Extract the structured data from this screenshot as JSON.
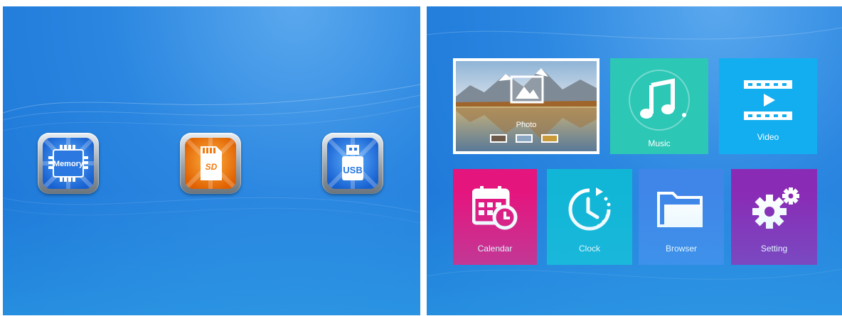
{
  "left_screen": {
    "sources": [
      {
        "name": "Memory",
        "icon": "memory-chip-icon",
        "color": "#2f7de6"
      },
      {
        "name": "SD",
        "icon": "sd-card-icon",
        "color": "#f07a10"
      },
      {
        "name": "USB",
        "icon": "usb-drive-icon",
        "color": "#2f7de6"
      }
    ]
  },
  "right_screen": {
    "tiles": {
      "photo": {
        "label": "Photo",
        "icon": "image-icon",
        "selected": true
      },
      "music": {
        "label": "Music",
        "icon": "music-note-icon",
        "color": "#2cc7b5"
      },
      "video": {
        "label": "Video",
        "icon": "film-play-icon",
        "color": "#13aef0"
      },
      "calendar": {
        "label": "Calendar",
        "icon": "calendar-clock-icon",
        "color": "#e5157e"
      },
      "clock": {
        "label": "Clock",
        "icon": "clock-icon",
        "color": "#11b6d6"
      },
      "browser": {
        "label": "Browser",
        "icon": "folder-icon",
        "color": "#3f86e8"
      },
      "setting": {
        "label": "Setting",
        "icon": "gears-icon",
        "color": "#8a2bb5"
      }
    }
  }
}
